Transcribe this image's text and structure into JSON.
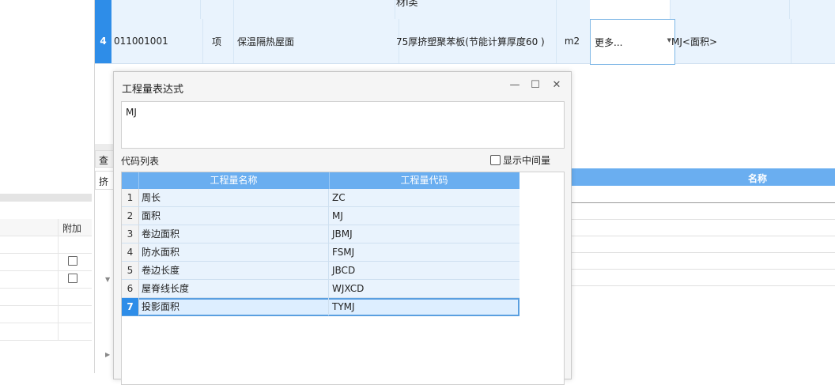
{
  "top_grid": {
    "row3": {
      "num": "",
      "col_material": "材Ⅰ类"
    },
    "row4": {
      "num": "4",
      "code": "011001001",
      "unit_type": "项",
      "name": "保温隔热屋面",
      "feature": "75厚挤塑聚苯板(节能计算厚度60 )",
      "unit": "m2",
      "more": "更多...",
      "expression": "MJ<面积>"
    }
  },
  "left_table": {
    "header": "附加"
  },
  "main_tabs": {
    "query": "查",
    "extrude": "挤"
  },
  "right_table": {
    "header_name": "名称"
  },
  "dialog": {
    "title": "工程量表达式",
    "minimize": "—",
    "maximize": "☐",
    "close": "✕",
    "expression_value": "MJ",
    "code_list_label": "代码列表",
    "show_intermediate_label": "显示中间量",
    "columns": [
      "工程量名称",
      "工程量代码"
    ],
    "rows": [
      {
        "num": "1",
        "name": "周长",
        "code": "ZC"
      },
      {
        "num": "2",
        "name": "面积",
        "code": "MJ"
      },
      {
        "num": "3",
        "name": "卷边面积",
        "code": "JBMJ"
      },
      {
        "num": "4",
        "name": "防水面积",
        "code": "FSMJ"
      },
      {
        "num": "5",
        "name": "卷边长度",
        "code": "JBCD"
      },
      {
        "num": "6",
        "name": "屋脊线长度",
        "code": "WJXCD"
      },
      {
        "num": "7",
        "name": "投影面积",
        "code": "TYMJ"
      }
    ]
  },
  "colors": {
    "accent": "#2e8de8",
    "header_blue": "#6aaef0",
    "row_bg": "#e9f3fd"
  }
}
